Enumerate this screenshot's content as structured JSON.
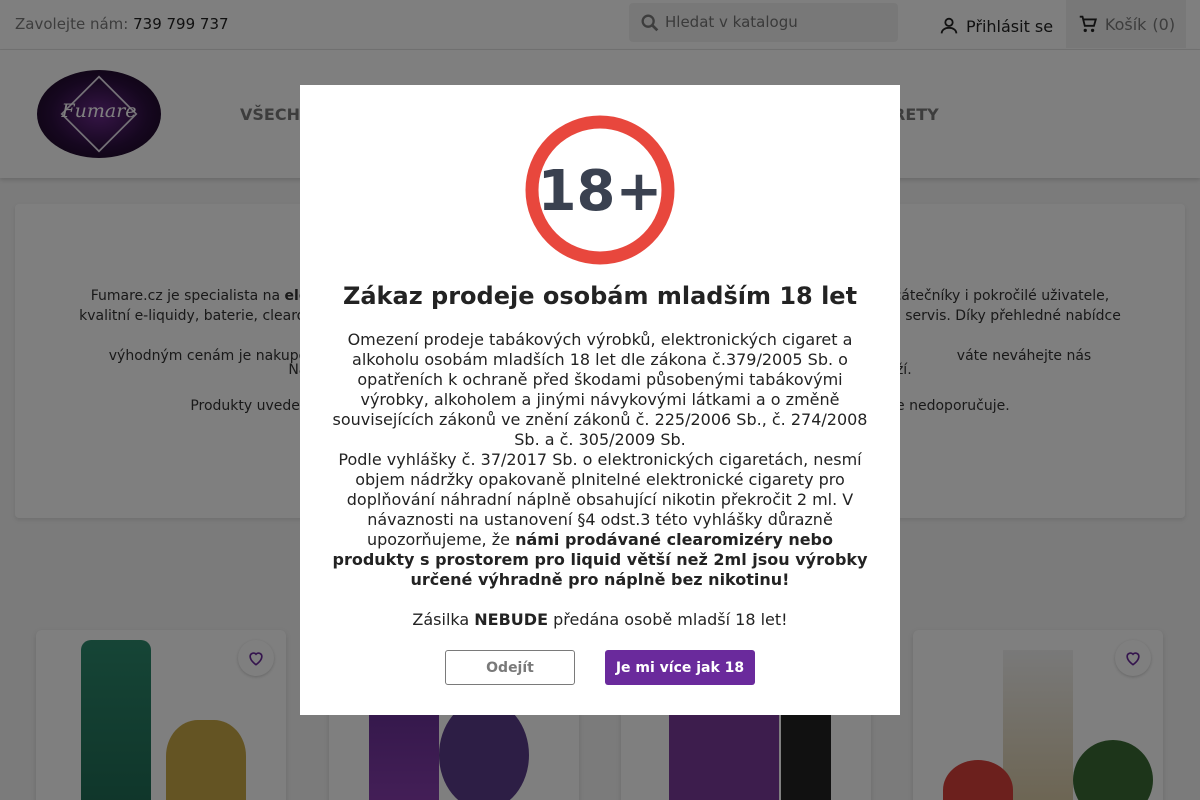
{
  "topbar": {
    "contact_label": "Zavolejte nám:",
    "phone": "739 799 737",
    "search_placeholder": "Hledat v katalogu",
    "login_label": "Přihlásit se",
    "cart_label": "Košík",
    "cart_count": "(0)"
  },
  "header": {
    "logo_text": "Fumare",
    "nav_item_1": "VŠECHN",
    "nav_item_2": "RETY"
  },
  "content": {
    "p1_line1_start": "Fumare.cz je specialista na",
    "p1_line1_bold": "elek",
    "p1_line1_end": "začátečníky i pokročilé uživatele,",
    "p1_line2_start": "kvalitní e-liquidy, baterie, clearo",
    "p1_line2_end": "servis. Díky přehledné nabídce a",
    "p1_line3_start": "výhodným cenám je nakupování",
    "p1_line3_end": "váte neváhejte nás kontaktovat.",
    "p2_start": "Na",
    "p2_end": "oží.",
    "p3_start": "Produkty uveden",
    "p3_end": "se nedoporučuje."
  },
  "modal": {
    "badge_text": "18+",
    "title": "Zákaz prodeje osobám mladším 18 let",
    "text1": "Omezení prodeje tabákových výrobků, elektronických cigaret a alkoholu osobám mladších 18 let dle zákona č.379/2005 Sb. o opatřeních k ochraně před škodami působenými tabákovými výrobky, alkoholem a jinými návykovými látkami a o změně souvisejících zákonů ve znění zákonů č. 225/2006 Sb., č. 274/2008 Sb. a č. 305/2009 Sb.",
    "text2_normal": "Podle vyhlášky č. 37/2017 Sb. o elektronických cigaretách, nesmí objem nádržky opakovaně plnitelné elektronické cigarety pro doplňování náhradní náplně obsahující nikotin překročit 2 ml. V návaznosti na ustanovení §4 odst.3 této vyhlášky důrazně upozorňujeme, že ",
    "text2_bold": "námi prodávané clearomizéry nebo produkty s prostorem pro liquid větší než 2ml jsou výrobky určené výhradně pro náplně bez nikotinu!",
    "text3_start": "Zásilka ",
    "text3_bold": "NEBUDE",
    "text3_end": " předána osobě mladší 18 let!",
    "leave_button": "Odejít",
    "accept_button": "Je mi více jak 18"
  },
  "colors": {
    "accent": "#6a2a9c",
    "badge_ring": "#e8473d",
    "badge_text": "#3a4150"
  }
}
